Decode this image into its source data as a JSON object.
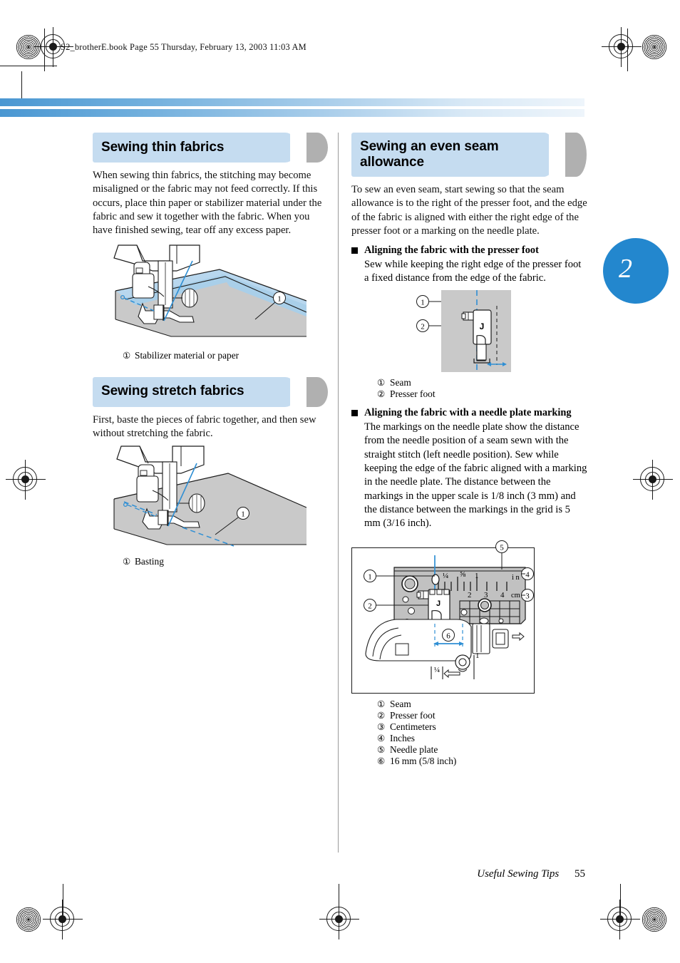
{
  "page": {
    "running_header": "S2_brotherE.book  Page 55  Thursday, February 13, 2003  11:03 AM",
    "chapter_number": "2",
    "footer_title": "Useful Sewing Tips",
    "footer_page": "55",
    "accent_blue": "#2387ce",
    "band_blue": "#c5dcf0",
    "band_gray": "#b0b0b0",
    "line_blue": "#2f8fd4"
  },
  "left_column": {
    "sections": [
      {
        "heading": "Sewing thin fabrics",
        "paragraph": "When sewing thin fabrics, the stitching may become misaligned or the fabric may not feed correctly. If this occurs, place thin paper or stabilizer material under the fabric and sew it together with the fabric. When you have finished sewing, tear off any excess paper.",
        "figure_name": "thin-fabric-sewing-illustration",
        "callout_number": "①",
        "caption": {
          "num": "①",
          "text": "Stabilizer material or paper"
        }
      },
      {
        "heading": "Sewing stretch fabrics",
        "paragraph": "First, baste the pieces of fabric together, and then sew without stretching the fabric.",
        "figure_name": "stretch-fabric-sewing-illustration",
        "callout_number": "①",
        "caption": {
          "num": "①",
          "text": "Basting"
        }
      }
    ]
  },
  "right_column": {
    "heading_line1": "Sewing an even seam",
    "heading_line2": "allowance",
    "intro": "To sew an even seam, start sewing so that the seam allowance is to the right of the presser foot, and the edge of the fabric is aligned with either the right edge of the presser foot or a marking on the needle plate.",
    "subsections": [
      {
        "title": "Aligning the fabric with the presser foot",
        "body": "Sew while keeping the right edge of the presser foot a fixed distance from the edge of the fabric.",
        "figure_name": "presser-foot-alignment-diagram",
        "figure_labels": {
          "foot_letter": "J",
          "callout1": "①",
          "callout2": "②"
        },
        "legend": [
          {
            "num": "①",
            "text": "Seam"
          },
          {
            "num": "②",
            "text": "Presser foot"
          }
        ]
      },
      {
        "title": "Aligning the fabric with a needle plate marking",
        "body": "The markings on the needle plate show the distance from the needle position of a seam sewn with the straight stitch (left needle position). Sew while keeping the edge of the fabric aligned with a marking in the needle plate. The distance between the markings in the upper scale is 1/8 inch (3 mm) and the distance between the markings in the grid is 5 mm (3/16 inch).",
        "figure_name": "needle-plate-marking-diagram",
        "figure_labels": {
          "foot_letter": "J",
          "callout1": "①",
          "callout2": "②",
          "callout3": "③",
          "callout4": "④",
          "callout5": "⑤",
          "callout6": "⑥",
          "inch_unit": "i n",
          "cm_unit": "cm",
          "inch_ticks": [
            "¼",
            "⅝",
            "1"
          ],
          "cm_ticks": [
            "2",
            "3",
            "4"
          ],
          "lower_inch_label": "¼",
          "lower_one_label": "1"
        },
        "legend": [
          {
            "num": "①",
            "text": "Seam"
          },
          {
            "num": "②",
            "text": "Presser foot"
          },
          {
            "num": "③",
            "text": "Centimeters"
          },
          {
            "num": "④",
            "text": "Inches"
          },
          {
            "num": "⑤",
            "text": "Needle plate"
          },
          {
            "num": "⑥",
            "text": "16 mm (5/8 inch)"
          }
        ]
      }
    ]
  }
}
